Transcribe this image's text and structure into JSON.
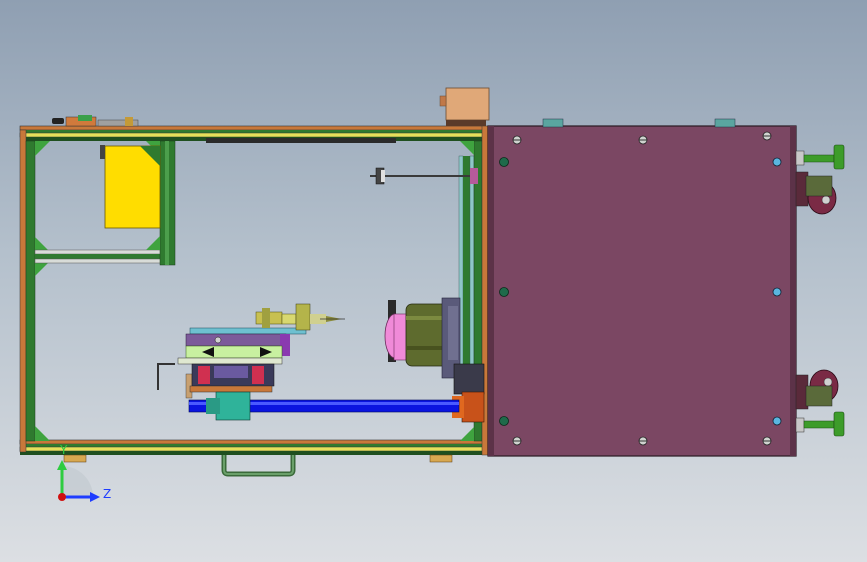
{
  "view": {
    "type": "CAD assembly view",
    "background_colors": [
      "#8f9fb2",
      "#dcdfe3"
    ]
  },
  "triad": {
    "y_label": "Y",
    "z_label": "Z",
    "y_color": "#2ecc40",
    "z_color": "#1e3cff",
    "origin_color": "#d01010"
  },
  "colors": {
    "cabinet": "#7b4763",
    "frame_green": "#2f7a2f",
    "rail_orange": "#c8783a",
    "yellow_panel": "#ffdd00",
    "blue_shaft": "#0a14e0",
    "motor_olive": "#5e6b2e",
    "motor_pink": "#f08ad8",
    "caster_green": "#3d9c2a",
    "caster_wheel": "#7a2a45"
  }
}
